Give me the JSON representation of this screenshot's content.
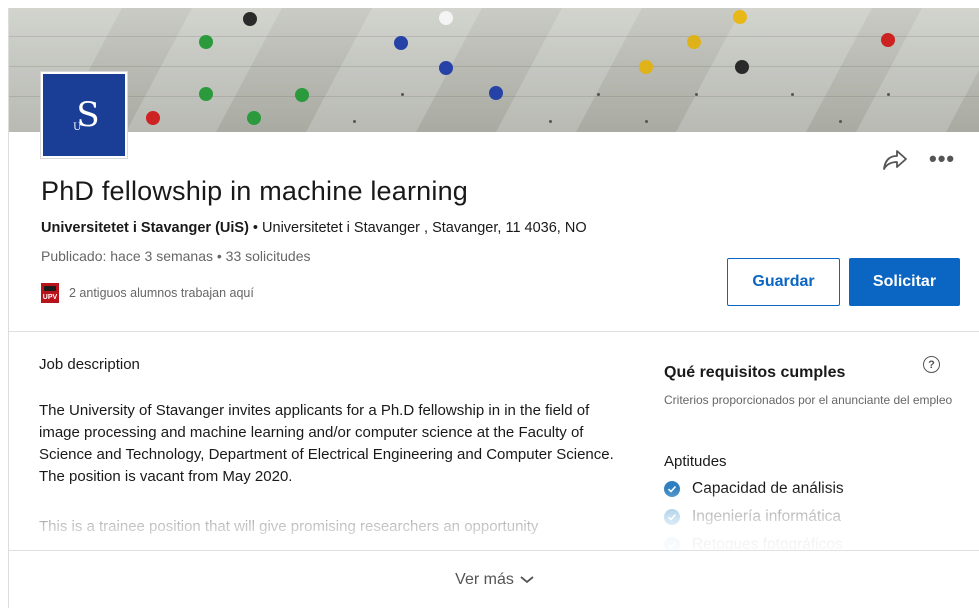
{
  "job": {
    "title": "PhD fellowship in machine learning",
    "company": "Universitetet i Stavanger (UiS)",
    "location_sep": " • ",
    "location": "Universitetet i Stavanger , Stavanger, 11 4036, NO",
    "posted": "Publicado: hace 3 semanas • 33 solicitudes",
    "alumni_text": "2 antiguos alumnos trabajan aquí",
    "alumni_logo_text": "UPV"
  },
  "actions": {
    "save_label": "Guardar",
    "apply_label": "Solicitar",
    "share_icon": "share-arrow-icon",
    "more_icon": "more-horizontal-icon",
    "more_glyph": "•••"
  },
  "logo": {
    "letter": "S",
    "small": "U"
  },
  "description": {
    "heading": "Job description",
    "paragraph1": "The University of Stavanger invites applicants for a Ph.D fellowship in in the field of image processing and machine learning and/or computer science at the Faculty of Science and Technology, Department of Electrical Engineering and Computer Science. The position is vacant from May 2020.",
    "paragraph2": "This is a trainee position that will give promising researchers an opportunity"
  },
  "requirements": {
    "title": "Qué requisitos cumples",
    "help_glyph": "?",
    "subtitle": "Criterios proporcionados por el anunciante del empleo",
    "skills_heading": "Aptitudes",
    "skills": [
      {
        "label": "Capacidad de análisis"
      },
      {
        "label": "Ingeniería informática"
      },
      {
        "label": "Retoques fotográficos"
      }
    ]
  },
  "footer": {
    "see_more": "Ver más"
  },
  "colors": {
    "brand_blue": "#0a66c2",
    "uis_blue": "#1a3e96",
    "check_blue": "#2e7fbf",
    "upv_red": "#b8131b"
  }
}
